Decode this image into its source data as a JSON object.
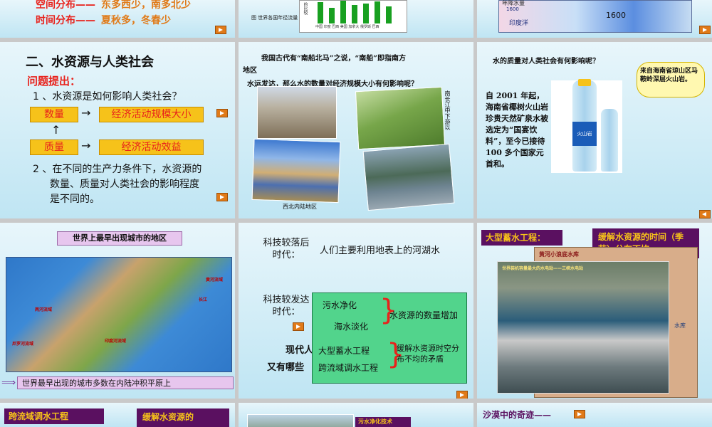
{
  "s1": {
    "space_label": "空间分布——",
    "space_value": "东多西少，南多北少",
    "time_label": "时间分布——",
    "time_value": "夏秋多，冬春少"
  },
  "s2": {
    "caption": "图 世界各国年径流量",
    "ylabel": "的比较",
    "xlabels": "中国 印度 巴西 美国 加拿大 俄罗斯 巴西"
  },
  "s3": {
    "tick1": "1600",
    "tick2": "1600",
    "place": "印度洋",
    "legend": "年降水量"
  },
  "s4": {
    "title": "二、水资源与人类社会",
    "question": "问题提出：",
    "q1": "1 、水资源是如何影响人类社会？",
    "box_quantity": "数量",
    "box_scale": "经济活动规模大小",
    "box_quality": "质量",
    "box_benefit": "经济活动效益",
    "q2a": "2 、在不同的生产力条件下，水资源的",
    "q2b": "数量、质量对人类社会的影响程度",
    "q2c": "是不同的。",
    "arrow": "→",
    "arrow2": "→",
    "uparrow": "↑"
  },
  "s5": {
    "text1": "我国古代有“南船北马”之说，“南船”即指南方",
    "text2": "地区",
    "text3": "水运发达，那么水的数量对经济规模大小有何影响呢？",
    "side": "南长江中下游以",
    "caption": "西北内陆地区"
  },
  "s6": {
    "question": "水的质量对人类社会有何影响呢？",
    "bubble": "来自海南省琼山区马鞍岭深层火山岩。",
    "text": "自 2001 年起，海南省椰树火山岩珍贵天然矿泉水被选定为“国宴饮料”，至今已接待 100 多个国家元首和。",
    "bottle": "火山岩"
  },
  "s7": {
    "title": "世界上最早出现城市的地区",
    "footer": "世界最早出现的城市多数在内陆冲积平原上",
    "map_labels": [
      "黄河流域",
      "两河流域",
      "印度河流域",
      "尼罗河流域",
      "长江"
    ]
  },
  "s8": {
    "lagging_label": "科技较落后时代：",
    "lagging_text": "人们主要利用地表上的河湖水",
    "developed_label": "科技较发达时代：",
    "modern": "现代人",
    "other": "又有哪些",
    "item1": "污水净化",
    "item2": "海水淡化",
    "item3": "水资源的数量增加",
    "item4": "大型蓄水工程",
    "item5": "跨流域调水工程",
    "item6": "缓解水资源时空分布不均的矛盾"
  },
  "s9": {
    "title": "大型蓄水工程：",
    "badge": "缓解水资源的时间（季节）分布不均",
    "sub": "黄河小浪底水库",
    "caption": "世界装机容量最大的水电站——三峡水电站",
    "side": "水库"
  },
  "s10": {
    "title": "跨流域调水工程",
    "badge": "缓解水资源的"
  },
  "s11": {
    "badge": "污水净化技术"
  },
  "s12": {
    "title": "沙漠中的奇迹——"
  },
  "colors": {
    "accent": "#e07a18",
    "title_red": "#e8221c",
    "purple": "#5a1060",
    "yellow_box": "#f6c21a"
  }
}
